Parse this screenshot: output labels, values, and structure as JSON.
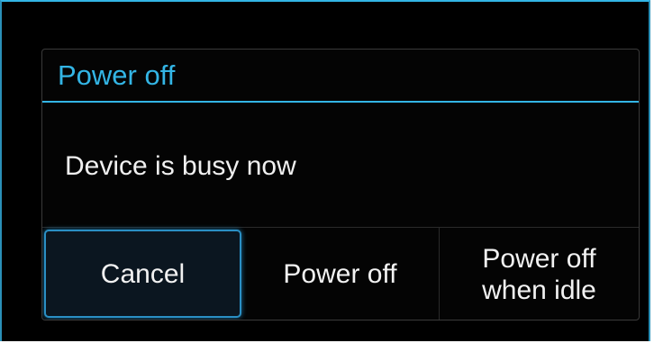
{
  "dialog": {
    "title": "Power off",
    "message": "Device is busy now",
    "buttons": {
      "cancel": "Cancel",
      "power_off": "Power off",
      "power_off_when_idle": "Power off\nwhen idle"
    }
  },
  "colors": {
    "accent": "#33b5e5",
    "background": "#000000",
    "text": "#f0f0f0",
    "focused_button_border": "#2a8fc4"
  }
}
